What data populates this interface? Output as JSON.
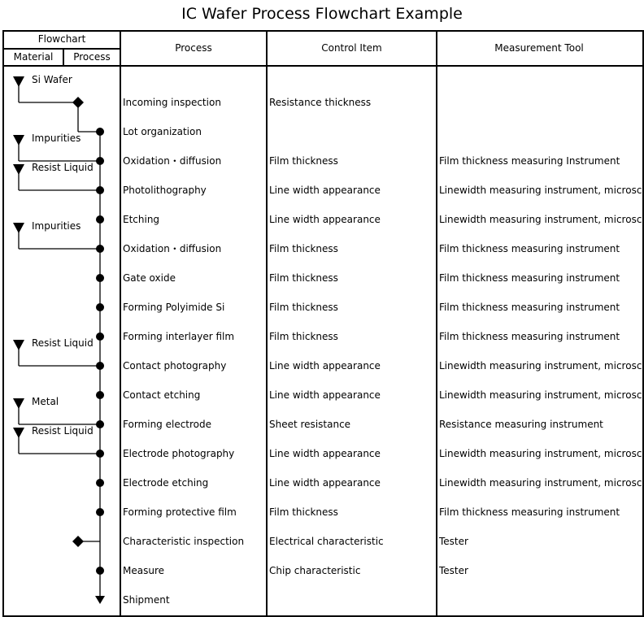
{
  "title": "IC Wafer Process Flowchart Example",
  "header": {
    "flowchart": "Flowchart",
    "material": "Material",
    "process_sub": "Process",
    "process": "Process",
    "control_item": "Control Item",
    "measurement_tool": "Measurement Tool"
  },
  "rows": [
    {
      "process": "Incoming inspection",
      "control": "Resistance thickness",
      "tool": "",
      "symbol": "diamond-branch"
    },
    {
      "process": "Lot organization",
      "control": "",
      "tool": "",
      "symbol": "dot"
    },
    {
      "process": "Oxidation・diffusion",
      "control": "Film thickness",
      "tool": "Film thickness measuring Instrument",
      "symbol": "dot"
    },
    {
      "process": "Photolithography",
      "control": "Line width appearance",
      "tool": "Linewidth measuring instrument, microscope",
      "symbol": "dot"
    },
    {
      "process": "Etching",
      "control": "Line width appearance",
      "tool": "Linewidth measuring instrument, microscope",
      "symbol": "dot"
    },
    {
      "process": "Oxidation・diffusion",
      "control": "Film thickness",
      "tool": "Film thickness measuring instrument",
      "symbol": "dot"
    },
    {
      "process": "Gate oxide",
      "control": "Film thickness",
      "tool": "Film thickness measuring instrument",
      "symbol": "dot"
    },
    {
      "process": "Forming Polyimide Si",
      "control": "Film thickness",
      "tool": "Film thickness measuring instrument",
      "symbol": "dot"
    },
    {
      "process": "Forming interlayer film",
      "control": "Film thickness",
      "tool": "Film thickness measuring instrument",
      "symbol": "dot"
    },
    {
      "process": "Contact photography",
      "control": "Line width appearance",
      "tool": "Linewidth measuring instrument, microscope",
      "symbol": "dot"
    },
    {
      "process": "Contact etching",
      "control": "Line width appearance",
      "tool": "Linewidth measuring instrument, microscope",
      "symbol": "dot"
    },
    {
      "process": "Forming electrode",
      "control": "Sheet resistance",
      "tool": "Resistance measuring instrument",
      "symbol": "dot"
    },
    {
      "process": "Electrode photography",
      "control": "Line width appearance",
      "tool": "Linewidth measuring instrument, microscope",
      "symbol": "dot"
    },
    {
      "process": "Electrode etching",
      "control": "Line width appearance",
      "tool": "Linewidth measuring instrument, microscope",
      "symbol": "dot"
    },
    {
      "process": "Forming protective film",
      "control": "Film thickness",
      "tool": "Film thickness measuring instrument",
      "symbol": "dot"
    },
    {
      "process": "Characteristic inspection",
      "control": "Electrical characteristic",
      "tool": "Tester",
      "symbol": "diamond-side"
    },
    {
      "process": "Measure",
      "control": "Chip characteristic",
      "tool": "Tester",
      "symbol": "dot"
    },
    {
      "process": "Shipment",
      "control": "",
      "tool": "",
      "symbol": "arrow-end"
    }
  ],
  "materials": [
    {
      "label": "Si Wafer",
      "joins_row": 0
    },
    {
      "label": "Impurities",
      "joins_row": 2
    },
    {
      "label": "Resist Liquid",
      "joins_row": 3
    },
    {
      "label": "Impurities",
      "joins_row": 5
    },
    {
      "label": "Resist Liquid",
      "joins_row": 9
    },
    {
      "label": "Metal",
      "joins_row": 11
    },
    {
      "label": "Resist Liquid",
      "joins_row": 12
    }
  ]
}
